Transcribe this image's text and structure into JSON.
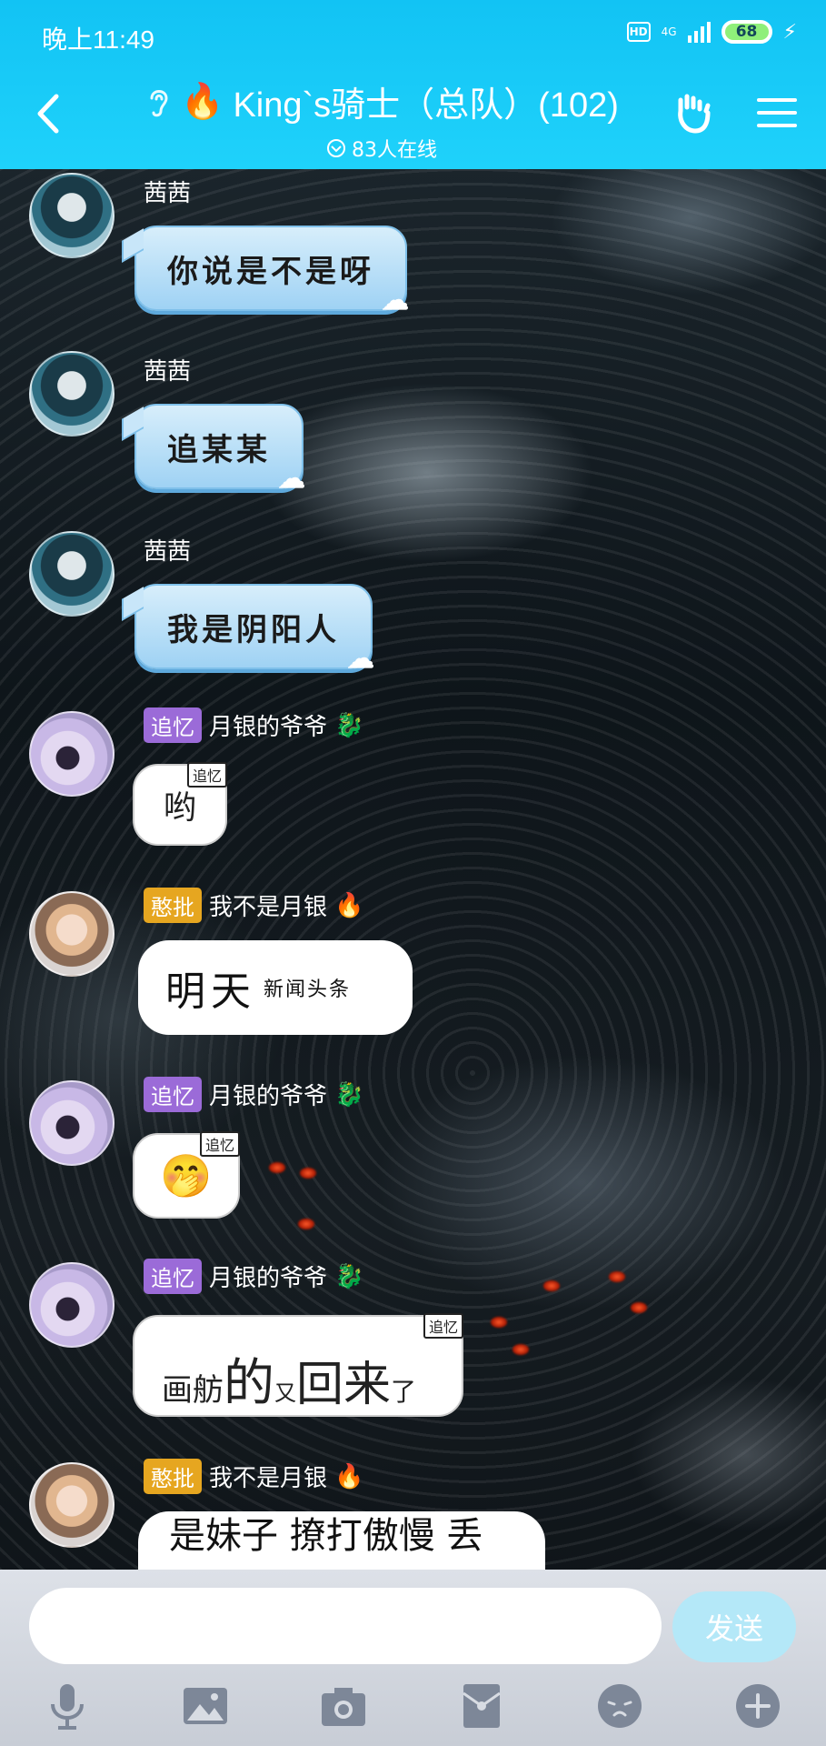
{
  "status_bar": {
    "time": "晚上11:49",
    "hd": "HD",
    "network": "4G",
    "battery": "68"
  },
  "header": {
    "title": "King`s骑士（总队）(102)",
    "online": "83人在线",
    "fire_emoji": "🔥"
  },
  "messages": [
    {
      "sender": "茜茜",
      "text": "你说是不是呀"
    },
    {
      "sender": "茜茜",
      "text": "追某某"
    },
    {
      "sender": "茜茜",
      "text": "我是阴阳人"
    },
    {
      "tag": "追忆",
      "sender": "月银的爷爷",
      "badge_emoji": "🐉",
      "corner_tag": "追忆",
      "text": "哟"
    },
    {
      "tag": "憨批",
      "sender": "我不是月银",
      "badge_emoji": "🔥",
      "text_big": "明天",
      "text_small": "新闻头条"
    },
    {
      "tag": "追忆",
      "sender": "月银的爷爷",
      "badge_emoji": "🐉",
      "corner_tag": "追忆",
      "emoji": "🤭"
    },
    {
      "tag": "追忆",
      "sender": "月银的爷爷",
      "badge_emoji": "🐉",
      "corner_tag": "追忆",
      "parts": [
        "画舫",
        "的",
        "又",
        "回来",
        "了"
      ]
    },
    {
      "tag": "憨批",
      "sender": "我不是月银",
      "badge_emoji": "🔥",
      "partial_text": "是妹子 撩打傲慢 丢丢"
    }
  ],
  "input": {
    "placeholder": "",
    "send_label": "发送"
  },
  "toolbar": [
    "microphone-icon",
    "image-icon",
    "camera-icon",
    "red-packet-icon",
    "emoji-icon",
    "plus-icon"
  ],
  "colors": {
    "header": "#1fcdfa",
    "tag_purple": "#9b6bd8",
    "tag_gold": "#e6a620",
    "send_button": "#b4e8f8"
  }
}
